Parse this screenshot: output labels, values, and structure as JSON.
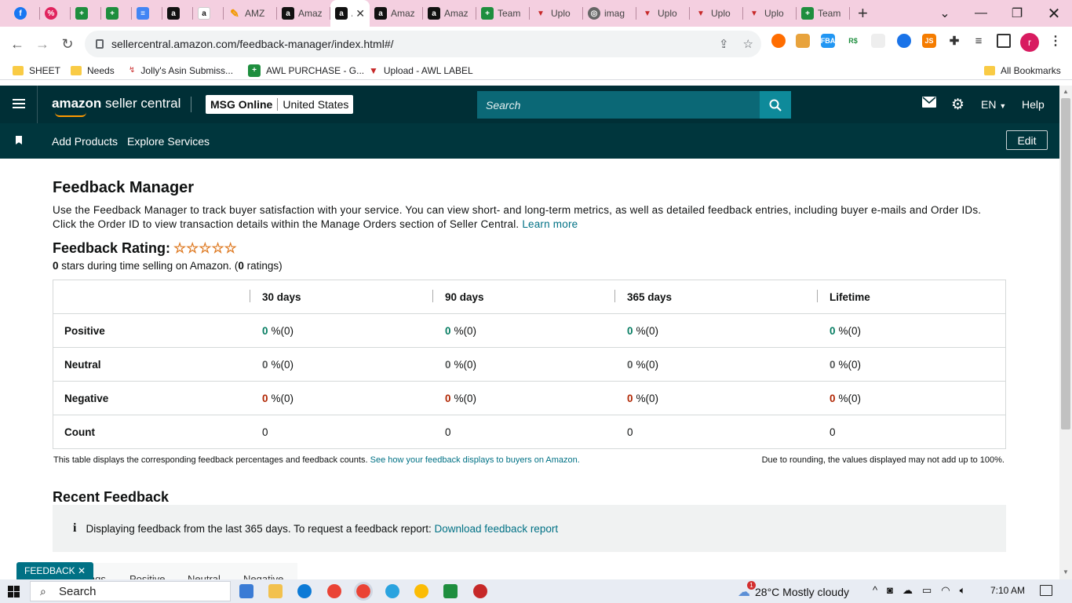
{
  "browser": {
    "tabs": [
      {
        "icon": "facebook-icon",
        "label": ""
      },
      {
        "icon": "percent-icon",
        "label": ""
      },
      {
        "icon": "sheets-icon",
        "label": ""
      },
      {
        "icon": "sheets-icon",
        "label": ""
      },
      {
        "icon": "docs-icon",
        "label": ""
      },
      {
        "icon": "amazon-icon",
        "label": ""
      },
      {
        "icon": "amazon-white-icon",
        "label": ""
      },
      {
        "icon": "pen-icon",
        "label": "AMZ"
      },
      {
        "icon": "amazon-icon",
        "label": "Amaz"
      },
      {
        "icon": "amazon-icon",
        "label": "A",
        "active": true
      },
      {
        "icon": "amazon-icon",
        "label": "Amaz"
      },
      {
        "icon": "amazon-icon",
        "label": "Amaz"
      },
      {
        "icon": "sheets-icon",
        "label": "Team"
      },
      {
        "icon": "upload-icon",
        "label": "Uplo"
      },
      {
        "icon": "globe-icon",
        "label": "imag"
      },
      {
        "icon": "upload-icon",
        "label": "Uplo"
      },
      {
        "icon": "upload-icon",
        "label": "Uplo"
      },
      {
        "icon": "upload-icon",
        "label": "Uplo"
      },
      {
        "icon": "sheets-icon",
        "label": "Team"
      }
    ],
    "url": "sellercentral.amazon.com/feedback-manager/index.html#/",
    "profile_initial": "r",
    "bookmarks": [
      {
        "icon": "folder-icon",
        "label": "SHEET"
      },
      {
        "icon": "folder-icon",
        "label": "Needs"
      },
      {
        "icon": "asin-icon",
        "label": "Jolly's Asin Submiss..."
      },
      {
        "icon": "sheets-icon",
        "label": "AWL PURCHASE - G..."
      },
      {
        "icon": "upload-icon",
        "label": "Upload - AWL LABEL"
      }
    ],
    "all_bookmarks": "All Bookmarks",
    "extensions": [
      "FBA",
      "R$",
      "JS"
    ]
  },
  "header": {
    "logo_bold": "amazon",
    "logo_rest": " seller central",
    "store": "MSG Online",
    "marketplace": "United States",
    "search_placeholder": "Search",
    "language": "EN",
    "help": "Help",
    "nav": [
      "Add Products",
      "Explore Services"
    ],
    "edit": "Edit"
  },
  "main": {
    "title": "Feedback Manager",
    "intro": "Use the Feedback Manager to track buyer satisfaction with your service. You can view short- and long-term metrics, as well as detailed feedback entries, including buyer e-mails and Order IDs. Click the Order ID to view transaction details within the Manage Orders section of Seller Central.",
    "learn_more": "Learn more",
    "rating_label": "Feedback Rating:",
    "stars": "☆☆☆☆☆",
    "stars_value": "0",
    "stars_text": " stars during time selling on Amazon. (",
    "ratings_count": "0",
    "ratings_text": " ratings)",
    "table": {
      "columns": [
        "",
        "30 days",
        "90 days",
        "365 days",
        "Lifetime"
      ],
      "rows": [
        {
          "label": "Positive",
          "kind": "pos",
          "values": [
            "0",
            "0",
            "0",
            "0"
          ],
          "suffix": " %(0)"
        },
        {
          "label": "Neutral",
          "kind": "neu",
          "values": [
            "0",
            "0",
            "0",
            "0"
          ],
          "suffix": " %(0)"
        },
        {
          "label": "Negative",
          "kind": "neg",
          "values": [
            "0",
            "0",
            "0",
            "0"
          ],
          "suffix": " %(0)"
        },
        {
          "label": "Count",
          "kind": "count",
          "values": [
            "0",
            "0",
            "0",
            "0"
          ],
          "suffix": ""
        }
      ]
    },
    "note_left": "This table displays the corresponding feedback percentages and feedback counts.",
    "note_link": "See how your feedback displays to buyers on Amazon.",
    "note_right": "Due to rounding, the values displayed may not add up to 100%.",
    "recent_title": "Recent Feedback",
    "info_text": "Displaying feedback from the last 365 days. To request a feedback report:",
    "info_link": "Download feedback report",
    "subtabs": [
      "ings",
      "Positive",
      "Neutral",
      "Negative"
    ],
    "feedback_button": "FEEDBACK ✕"
  },
  "taskbar": {
    "search": "Search",
    "weather": "28°C  Mostly cloudy",
    "time": "7:10 AM",
    "weather_badge": "1"
  }
}
